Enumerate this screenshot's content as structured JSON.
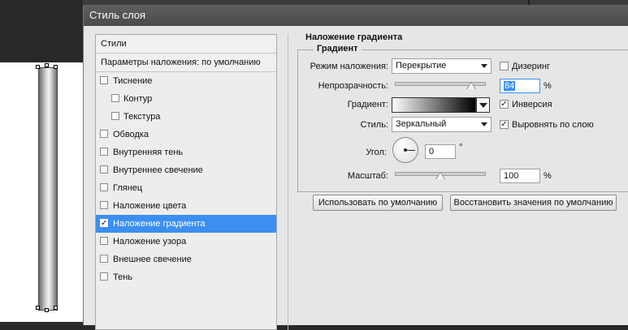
{
  "dialog": {
    "title": "Стиль слоя"
  },
  "left_panel": {
    "header": "Стили",
    "blending_defaults": "Параметры наложения: по умолчанию",
    "items": [
      {
        "label": "Тиснение",
        "checked": false,
        "indent": false,
        "active": false
      },
      {
        "label": "Контур",
        "checked": false,
        "indent": true,
        "active": false
      },
      {
        "label": "Текстура",
        "checked": false,
        "indent": true,
        "active": false
      },
      {
        "label": "Обводка",
        "checked": false,
        "indent": false,
        "active": false
      },
      {
        "label": "Внутренняя тень",
        "checked": false,
        "indent": false,
        "active": false
      },
      {
        "label": "Внутреннее свечение",
        "checked": false,
        "indent": false,
        "active": false
      },
      {
        "label": "Глянец",
        "checked": false,
        "indent": false,
        "active": false
      },
      {
        "label": "Наложение цвета",
        "checked": false,
        "indent": false,
        "active": false
      },
      {
        "label": "Наложение градиента",
        "checked": true,
        "indent": false,
        "active": true
      },
      {
        "label": "Наложение узора",
        "checked": false,
        "indent": false,
        "active": false
      },
      {
        "label": "Внешнее свечение",
        "checked": false,
        "indent": false,
        "active": false
      },
      {
        "label": "Тень",
        "checked": false,
        "indent": false,
        "active": false
      }
    ]
  },
  "gradient_overlay": {
    "section_title": "Наложение градиента",
    "group_title": "Градиент",
    "blend_mode_label": "Режим наложения:",
    "blend_mode_value": "Перекрытие",
    "dither_label": "Дизеринг",
    "dither_checked": false,
    "opacity_label": "Непрозрачность:",
    "opacity_value": "84",
    "opacity_unit": "%",
    "opacity_fraction": 0.84,
    "gradient_label": "Градиент:",
    "reverse_label": "Инверсия",
    "reverse_checked": true,
    "style_label": "Стиль:",
    "style_value": "Зеркальный",
    "align_label": "Выровнять по слою",
    "align_checked": true,
    "angle_label": "Угол:",
    "angle_value": "0",
    "angle_unit": "°",
    "scale_label": "Масштаб:",
    "scale_value": "100",
    "scale_unit": "%",
    "scale_fraction": 0.5
  },
  "buttons": {
    "make_default": "Использовать по умолчанию",
    "reset_default": "Восстановить значения по умолчанию"
  },
  "colors": {
    "accent": "#3b8ff0",
    "dialog_bg": "#e6e6e6",
    "titlebar": "#4f4f4f"
  },
  "icons": {
    "checked": "✓"
  }
}
